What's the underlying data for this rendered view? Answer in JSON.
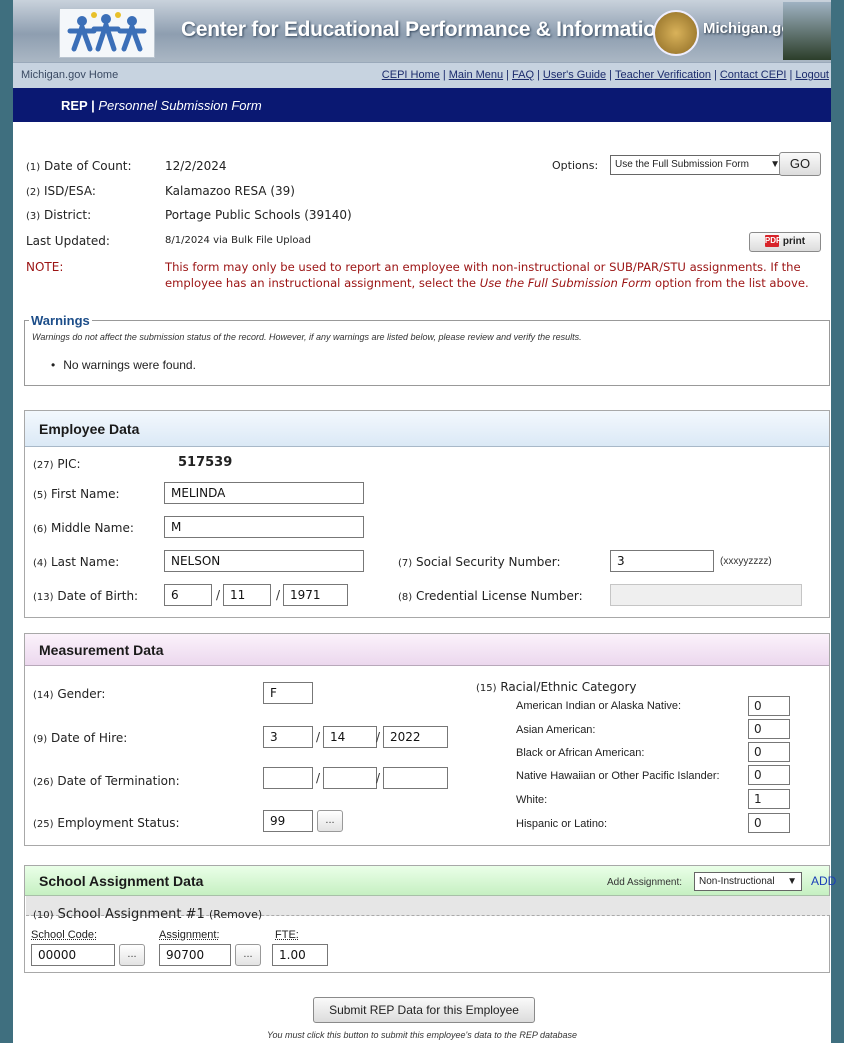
{
  "banner": {
    "title": "Center for Educational Performance & Information",
    "mi_logo": "Michigan.gov"
  },
  "nav": {
    "home": "Michigan.gov Home",
    "links": [
      "CEPI Home",
      "Main Menu",
      "FAQ",
      "User's Guide",
      "Teacher Verification",
      "Contact CEPI",
      "Logout"
    ]
  },
  "title_bar": {
    "rep": "REP |",
    "form": "Personnel Submission Form"
  },
  "info": {
    "date_count_num": "(1)",
    "date_count_label": "Date of Count:",
    "date_count": "12/2/2024",
    "isd_num": "(2)",
    "isd_label": "ISD/ESA:",
    "isd": "Kalamazoo RESA (39)",
    "district_num": "(3)",
    "district_label": "District:",
    "district": "Portage Public Schools (39140)",
    "updated_label": "Last Updated:",
    "updated": "8/1/2024 via Bulk File Upload",
    "note_label": "NOTE:",
    "note_line1": "This form may only be used to report an employee with non-instructional or SUB/PAR/STU assignments. If the",
    "note_line2_a": "employee has an instructional assignment, select the ",
    "note_line2_em": "Use the Full Submission Form",
    "note_line2_b": " option from the list above.",
    "options_label": "Options:",
    "options_value": "Use the Full Submission Form",
    "go": "GO",
    "print": "print",
    "pdf_icon": "PDF"
  },
  "warnings": {
    "legend": "Warnings",
    "desc": "Warnings do not affect the submission status of the record. However, if any warnings are listed below, please review and verify the results.",
    "item": "No warnings were found."
  },
  "employee": {
    "heading": "Employee Data",
    "pic_num": "(27)",
    "pic_label": "PIC:",
    "pic": "517539",
    "first_num": "(5)",
    "first_label": "First Name:",
    "first": "MELINDA",
    "middle_num": "(6)",
    "middle_label": "Middle Name:",
    "middle": "M",
    "last_num": "(4)",
    "last_label": "Last Name:",
    "last": "NELSON",
    "dob_num": "(13)",
    "dob_label": "Date of Birth:",
    "dob_m": "6",
    "dob_d": "11",
    "dob_y": "1971",
    "ssn_num": "(7)",
    "ssn_label": "Social Security Number:",
    "ssn": "3",
    "ssn_hint": "(xxxyyzzzz)",
    "cred_num": "(8)",
    "cred_label": "Credential License Number:",
    "cred": ""
  },
  "measurement": {
    "heading": "Measurement Data",
    "gender_num": "(14)",
    "gender_label": "Gender:",
    "gender": "F",
    "hire_num": "(9)",
    "hire_label": "Date of Hire:",
    "hire_m": "3",
    "hire_d": "14",
    "hire_y": "2022",
    "term_num": "(26)",
    "term_label": "Date of Termination:",
    "term_m": "",
    "term_d": "",
    "term_y": "",
    "status_num": "(25)",
    "status_label": "Employment Status:",
    "status": "99",
    "lookup": "...",
    "race_num": "(15)",
    "race_heading": "Racial/Ethnic Category",
    "races": [
      {
        "label": "American Indian or Alaska Native:",
        "value": "0"
      },
      {
        "label": "Asian American:",
        "value": "0"
      },
      {
        "label": "Black or African American:",
        "value": "0"
      },
      {
        "label": "Native Hawaiian or Other Pacific Islander:",
        "value": "0"
      },
      {
        "label": "White:",
        "value": "1"
      },
      {
        "label": "Hispanic or Latino:",
        "value": "0"
      }
    ]
  },
  "assignment": {
    "heading": "School Assignment Data",
    "add_label": "Add Assignment:",
    "add_value": "Non-Instructional",
    "add": "ADD",
    "item_num": "(10)",
    "item_title": "School Assignment #1",
    "remove": "(Remove)",
    "school_code_label": "School Code:",
    "school_code": "00000",
    "assignment_label": "Assignment:",
    "assignment": "90700",
    "fte_label": "FTE:",
    "fte": "1.00",
    "lookup": "..."
  },
  "submit": {
    "button": "Submit REP Data for this Employee",
    "note": "You must click this button to submit this employee's data to the REP database"
  }
}
